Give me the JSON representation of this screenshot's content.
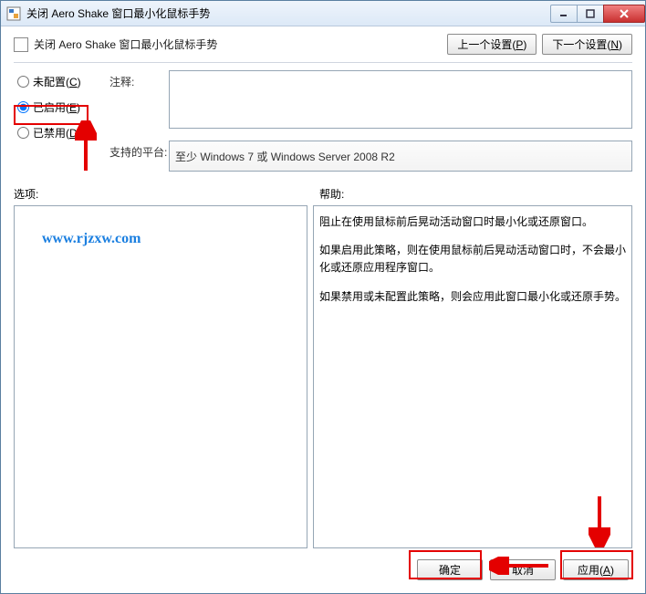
{
  "titlebar": {
    "title": "关闭 Aero Shake 窗口最小化鼠标手势"
  },
  "header": {
    "title": "关闭 Aero Shake 窗口最小化鼠标手势"
  },
  "nav": {
    "prev": "上一个设置(",
    "prev_u": "P",
    "prev_tail": ")",
    "next": "下一个设置(",
    "next_u": "N",
    "next_tail": ")"
  },
  "radios": {
    "notconfigured": "未配置(",
    "notconfigured_u": "C",
    "enabled": "已启用(",
    "enabled_u": "E",
    "disabled": "已禁用(",
    "disabled_u": "D",
    "tail": ")"
  },
  "labels": {
    "comment": "注释:",
    "platform": "支持的平台:",
    "options": "选项:",
    "help": "帮助:"
  },
  "platform_value": "至少 Windows 7 或 Windows Server 2008 R2",
  "help": {
    "p1": "阻止在使用鼠标前后晃动活动窗口时最小化或还原窗口。",
    "p2": "如果启用此策略，则在使用鼠标前后晃动活动窗口时，不会最小化或还原应用程序窗口。",
    "p3": "如果禁用或未配置此策略，则会应用此窗口最小化或还原手势。"
  },
  "footer": {
    "ok": "确定",
    "cancel": "取消",
    "apply": "应用(",
    "apply_u": "A",
    "apply_tail": ")"
  },
  "watermark": "www.rjzxw.com"
}
